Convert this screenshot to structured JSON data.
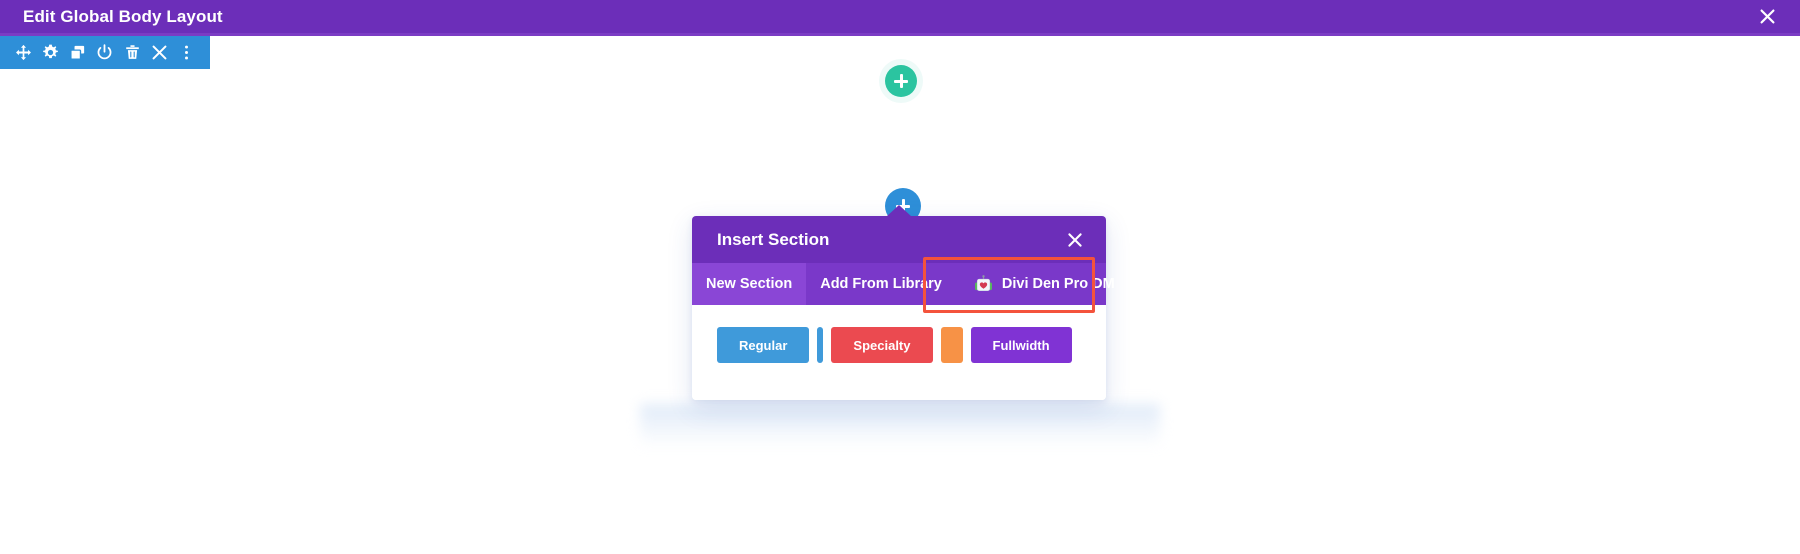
{
  "topbar": {
    "title": "Edit Global Body Layout",
    "close_icon": "close-icon"
  },
  "section_toolbar": {
    "tools": [
      {
        "name": "move-handle-icon",
        "label": "Move Section"
      },
      {
        "name": "gear-icon",
        "label": "Section Settings"
      },
      {
        "name": "duplicate-icon",
        "label": "Duplicate Section"
      },
      {
        "name": "power-toggle-icon",
        "label": "Disable Section"
      },
      {
        "name": "trash-icon",
        "label": "Delete Section"
      },
      {
        "name": "close-icon",
        "label": "Close"
      },
      {
        "name": "vertical-dots-icon",
        "label": "More Options"
      }
    ]
  },
  "canvas": {
    "add_section_top_label": "+",
    "add_section_bottom_label": "+"
  },
  "modal": {
    "title": "Insert Section",
    "close_icon": "close-icon",
    "tabs": [
      {
        "id": "new-section",
        "label": "New Section",
        "active": true,
        "icon": null
      },
      {
        "id": "add-from-library",
        "label": "Add From Library",
        "active": false,
        "icon": null
      },
      {
        "id": "divi-den-pro-dm",
        "label": "Divi Den Pro DM",
        "active": false,
        "icon": "divi-den-logo-icon",
        "highlighted": true
      }
    ],
    "layout_buttons": [
      {
        "id": "regular",
        "label": "Regular",
        "color": "#3f9ada"
      },
      {
        "id": "specialty",
        "label": "Specialty",
        "color": "#eb4a50"
      },
      {
        "id": "fullwidth",
        "label": "Fullwidth",
        "color": "#8033d4"
      }
    ],
    "slivers": [
      {
        "id": "regular-sliver",
        "color": "#3f9ada"
      },
      {
        "id": "specialty-sliver",
        "color": "#f79246"
      }
    ]
  },
  "colors": {
    "topbar_purple": "#6c2eb9",
    "toolbar_blue": "#2e8fd8",
    "tabs_purple": "#7a38c9",
    "tab_active_purple": "#8a46d6",
    "highlight_red": "#f4533c",
    "add_green": "#2bc4a0"
  }
}
